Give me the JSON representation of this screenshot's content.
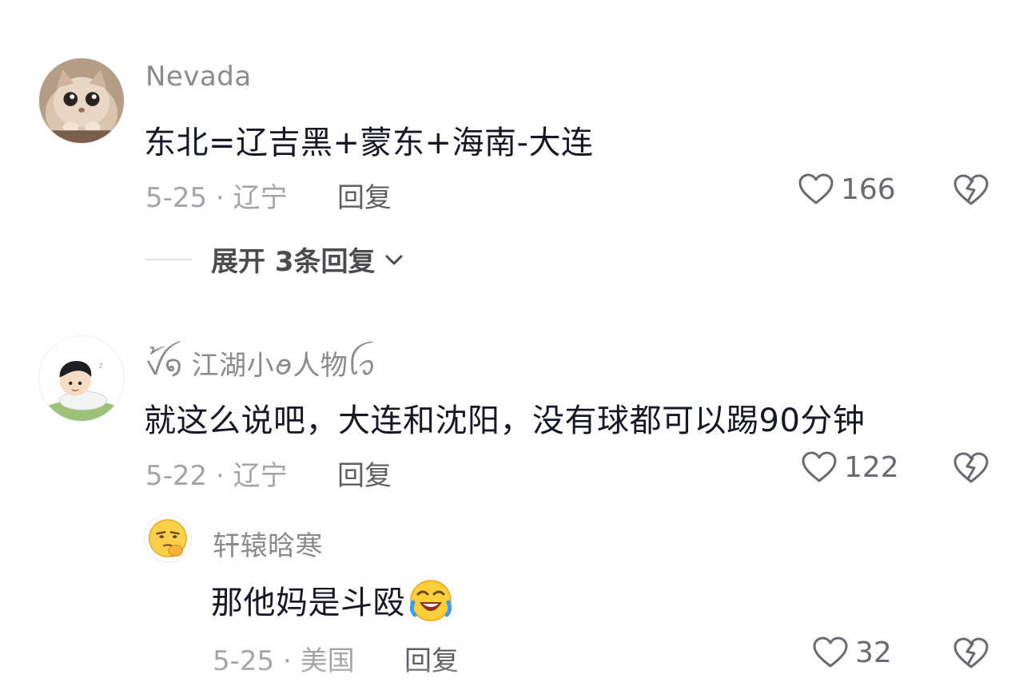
{
  "comments": [
    {
      "username": "Nevada",
      "text": "东北=辽吉黑+蒙东+海南-大连",
      "date_location": "5-25 · 辽宁",
      "reply_label": "回复",
      "likes": "166",
      "expand_label": "展开 3条回复",
      "avatar_icon": "cat-avatar"
    },
    {
      "username": "ꪜ꫁໑ 江湖小ꪮ人物ꪶꪫ",
      "text": "就这么说吧，大连和沈阳，没有球都可以踢90分钟",
      "date_location": "5-22 · 辽宁",
      "reply_label": "回复",
      "likes": "122",
      "avatar_icon": "cartoon-boy-avatar"
    }
  ],
  "replies": [
    {
      "username": "轩辕晗寒",
      "text": "那他妈是斗殴",
      "emoji": "rolling-laugh-emoji",
      "date_location": "5-25 · 美国",
      "reply_label": "回复",
      "likes": "32",
      "avatar_icon": "thinking-emoji-avatar"
    }
  ],
  "colors": {
    "text_primary": "#161823",
    "text_secondary": "#8a8a8f",
    "meta": "#a3a3a8",
    "icon": "#6a6a70"
  },
  "icons": {
    "like": "heart-outline-icon",
    "dislike": "broken-heart-icon",
    "chevron": "chevron-down-icon"
  }
}
